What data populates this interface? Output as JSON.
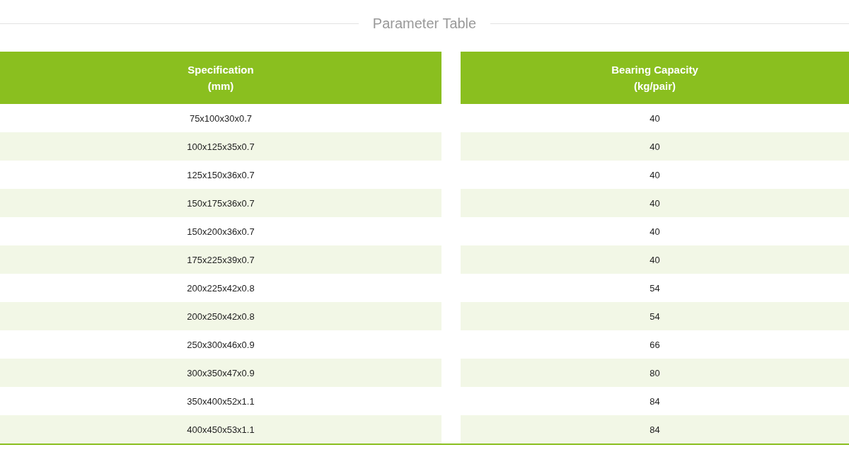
{
  "title": "Parameter Table",
  "table": {
    "columns": [
      {
        "label": "Specification",
        "unit": "(mm)"
      },
      {
        "label": "Bearing Capacity",
        "unit": "(kg/pair)"
      }
    ],
    "rows": [
      [
        "75x100x30x0.7",
        "40"
      ],
      [
        "100x125x35x0.7",
        "40"
      ],
      [
        "125x150x36x0.7",
        "40"
      ],
      [
        "150x175x36x0.7",
        "40"
      ],
      [
        "150x200x36x0.7",
        "40"
      ],
      [
        "175x225x39x0.7",
        "40"
      ],
      [
        "200x225x42x0.8",
        "54"
      ],
      [
        "200x250x42x0.8",
        "54"
      ],
      [
        "250x300x46x0.9",
        "66"
      ],
      [
        "300x350x47x0.9",
        "80"
      ],
      [
        "350x400x52x1.1",
        "84"
      ],
      [
        "400x450x53x1.1",
        "84"
      ]
    ]
  }
}
